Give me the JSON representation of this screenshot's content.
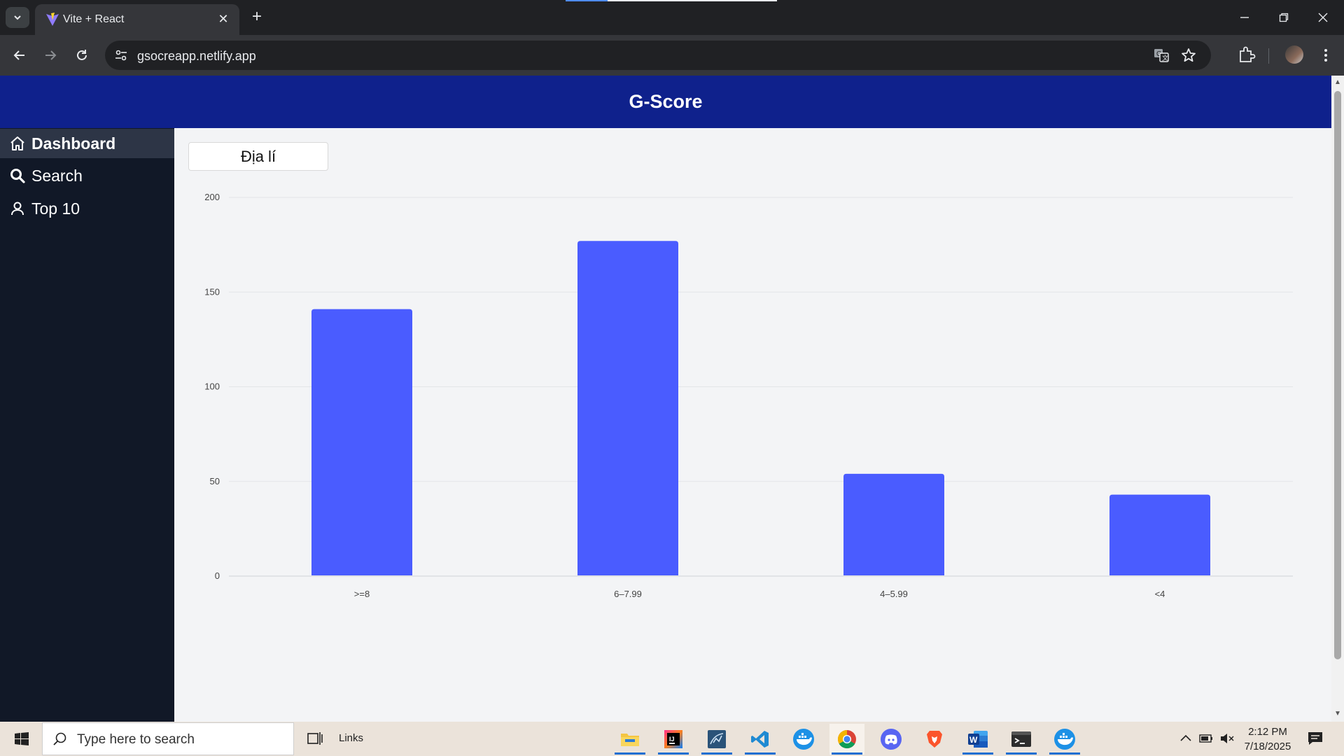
{
  "browser": {
    "tab_title": "Vite + React",
    "url": "gsocreapp.netlify.app"
  },
  "app": {
    "title": "G-Score",
    "sidebar": {
      "items": [
        {
          "label": "Dashboard",
          "icon": "home-icon",
          "active": true
        },
        {
          "label": "Search",
          "icon": "search-icon",
          "active": false
        },
        {
          "label": "Top 10",
          "icon": "user-icon",
          "active": false
        }
      ]
    },
    "subject_select": {
      "value": "Địa lí"
    }
  },
  "chart_data": {
    "type": "bar",
    "categories": [
      ">=8",
      "6–7.99",
      "4–5.99",
      "<4"
    ],
    "values": [
      141,
      177,
      54,
      43
    ],
    "ylim": [
      0,
      200
    ],
    "yticks": [
      0,
      50,
      100,
      150,
      200
    ],
    "grid": true,
    "bar_color": "#4a5cff"
  },
  "taskbar": {
    "search_placeholder": "Type here to search",
    "links_label": "Links",
    "apps": [
      {
        "icon": "file-explorer-icon"
      },
      {
        "icon": "intellij-icon"
      },
      {
        "icon": "mysql-workbench-icon"
      },
      {
        "icon": "vscode-icon"
      },
      {
        "icon": "docker-icon"
      },
      {
        "icon": "chrome-icon"
      },
      {
        "icon": "discord-icon"
      },
      {
        "icon": "brave-icon"
      },
      {
        "icon": "word-icon"
      },
      {
        "icon": "terminal-icon"
      },
      {
        "icon": "docker-desktop-icon"
      }
    ],
    "clock_time": "2:12 PM",
    "clock_date": "7/18/2025"
  },
  "colors": {
    "header_bg": "#0f218c",
    "sidebar_bg": "#111827",
    "bar": "#4a5cff"
  }
}
